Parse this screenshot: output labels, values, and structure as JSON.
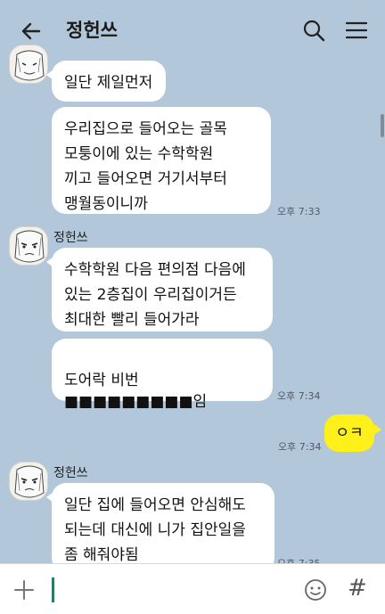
{
  "header": {
    "title": "정헌쓰",
    "back_icon": "arrow-left-icon",
    "search_icon": "search-icon",
    "menu_icon": "hamburger-menu-icon"
  },
  "messages": [
    {
      "sender": "",
      "text": "일단 제일먼저",
      "time": ""
    },
    {
      "sender": "",
      "text": "우리집으로 들어오는 골목\n모퉁이에 있는 수학학원\n끼고 들어오면 거기서부터\n맹월동이니까",
      "time": "오후 7:33"
    },
    {
      "sender": "정헌쓰",
      "text": "수학학원 다음 편의점 다음에\n있는 2층집이 우리집이거든\n최대한 빨리 들어가라",
      "time": ""
    },
    {
      "sender": "",
      "text": "도어락 비번\n■■■■■■■■■임",
      "time": "오후 7:34"
    },
    {
      "sender": "me",
      "text": "ㅇㅋ",
      "time": "오후 7:34"
    },
    {
      "sender": "정헌쓰",
      "text": "일단 집에 들어오면 안심해도\n되는데 대신에 니가 집안일을\n좀 해줘야됨",
      "time": "오후 7:35"
    }
  ],
  "input_bar": {
    "plus_icon": "plus-icon",
    "emoji_icon": "emoji-icon",
    "hash_label": "#"
  },
  "colors": {
    "background": "#b2c7da",
    "my_bubble": "#fef01b",
    "their_bubble": "#ffffff"
  }
}
